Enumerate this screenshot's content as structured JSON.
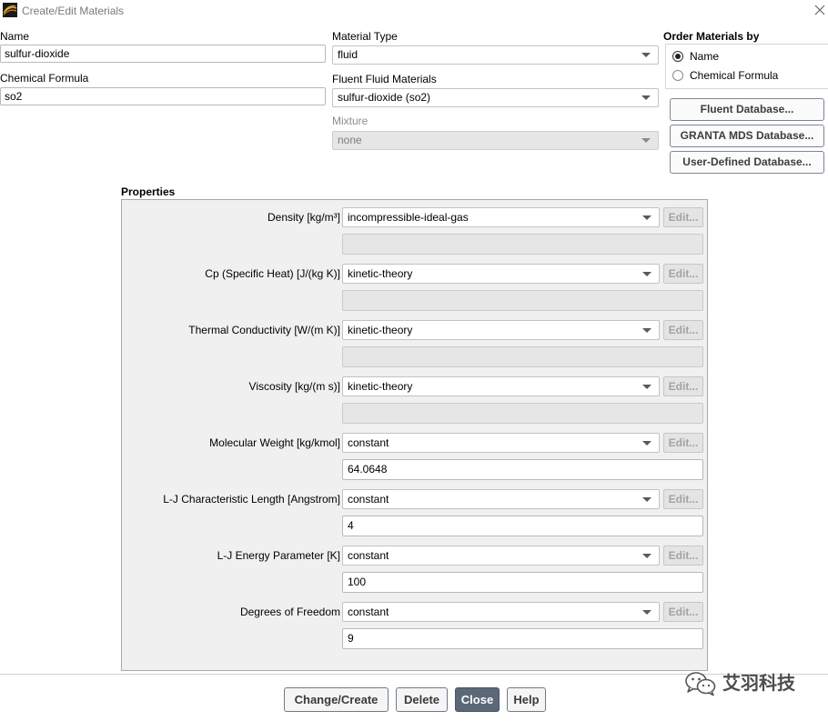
{
  "window": {
    "title": "Create/Edit Materials"
  },
  "icons": {
    "app": "fluent-logo-icon",
    "close": "close-icon",
    "dropdown": "dropdown-arrow-icon",
    "watermark": "wechat-icon"
  },
  "name": {
    "label": "Name",
    "value": "sulfur-dioxide"
  },
  "chemical_formula": {
    "label": "Chemical Formula",
    "value": "so2"
  },
  "material_type": {
    "label": "Material Type",
    "value": "fluid",
    "disabled": false
  },
  "fluent_fluid_materials": {
    "label": "Fluent Fluid Materials",
    "value": "sulfur-dioxide (so2)",
    "disabled": false
  },
  "mixture": {
    "label": "Mixture",
    "value": "none",
    "disabled": true
  },
  "order_by": {
    "label": "Order Materials by",
    "options": [
      {
        "label": "Name",
        "selected": true
      },
      {
        "label": "Chemical Formula",
        "selected": false
      }
    ]
  },
  "database_buttons": [
    "Fluent Database...",
    "GRANTA MDS Database...",
    "User-Defined Database..."
  ],
  "properties": {
    "label": "Properties",
    "edit_button_label": "Edit...",
    "edit_buttons_disabled": true,
    "rows": [
      {
        "label": "Density [kg/m³]",
        "method": "incompressible-ideal-gas",
        "value": "",
        "value_enabled": false
      },
      {
        "label": "Cp (Specific Heat) [J/(kg K)]",
        "method": "kinetic-theory",
        "value": "",
        "value_enabled": false
      },
      {
        "label": "Thermal Conductivity [W/(m K)]",
        "method": "kinetic-theory",
        "value": "",
        "value_enabled": false
      },
      {
        "label": "Viscosity [kg/(m s)]",
        "method": "kinetic-theory",
        "value": "",
        "value_enabled": false
      },
      {
        "label": "Molecular Weight [kg/kmol]",
        "method": "constant",
        "value": "64.0648",
        "value_enabled": true
      },
      {
        "label": "L-J Characteristic Length [Angstrom]",
        "method": "constant",
        "value": "4",
        "value_enabled": true
      },
      {
        "label": "L-J Energy Parameter [K]",
        "method": "constant",
        "value": "100",
        "value_enabled": true
      },
      {
        "label": "Degrees of Freedom",
        "method": "constant",
        "value": "9",
        "value_enabled": true
      }
    ]
  },
  "actions": {
    "change_create": "Change/Create",
    "delete": "Delete",
    "close": "Close",
    "help": "Help"
  },
  "watermark": {
    "text": "艾羽科技"
  },
  "colors": {
    "primary_button_bg": "#5b6878",
    "primary_button_text": "#ffffff",
    "properties_panel_bg": "#f0f0f0"
  }
}
